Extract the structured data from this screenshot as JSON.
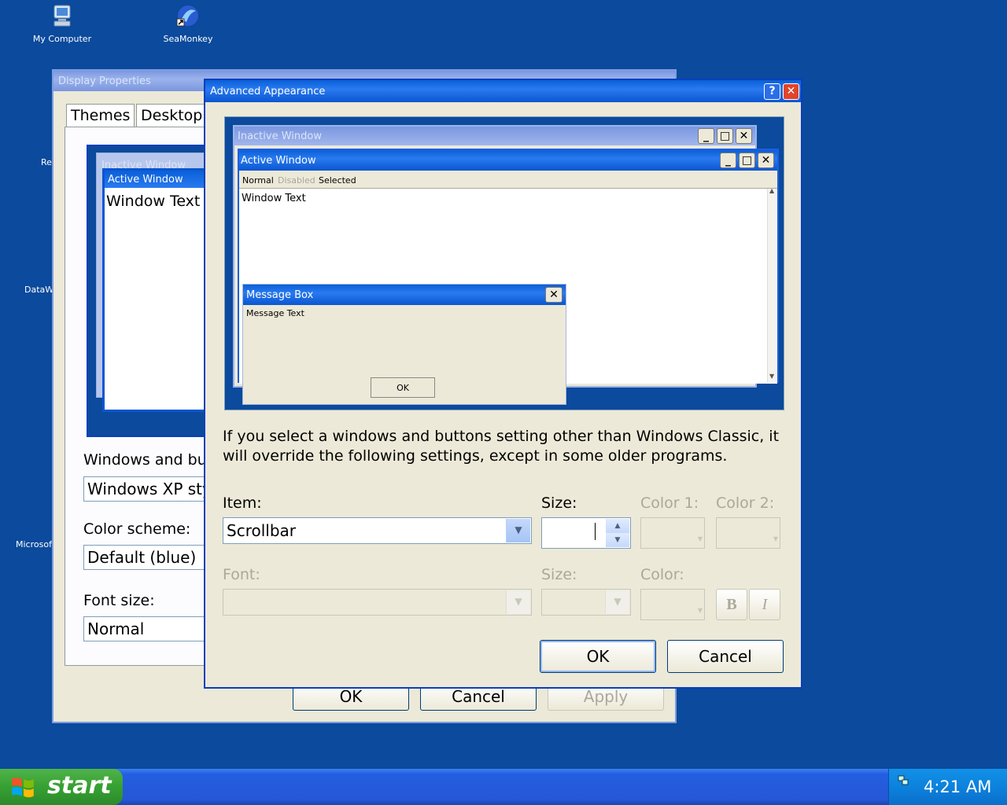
{
  "desktop": {
    "icons": [
      {
        "label": "My Computer",
        "icon": "computer-icon"
      },
      {
        "label": "SeaMonkey",
        "icon": "seamonkey-icon"
      }
    ],
    "edge_labels": [
      "Re",
      "DataW",
      "Microsoft"
    ]
  },
  "display_properties": {
    "title": "Display Properties",
    "tabs": [
      "Themes",
      "Desktop"
    ],
    "preview": {
      "inactive_window": "Inactive Window",
      "active_window": "Active Window",
      "window_text": "Window Text"
    },
    "windows_and_buttons_label": "Windows and bu",
    "windows_and_buttons_value": "Windows XP sty",
    "color_scheme_label": "Color scheme:",
    "color_scheme_value": "Default (blue)",
    "font_size_label": "Font size:",
    "font_size_value": "Normal",
    "ok": "OK",
    "cancel": "Cancel",
    "apply": "Apply"
  },
  "advanced": {
    "title": "Advanced Appearance",
    "help": "?",
    "preview": {
      "inactive_window": "Inactive Window",
      "active_window": "Active Window",
      "menu": {
        "normal": "Normal",
        "disabled": "Disabled",
        "selected": "Selected"
      },
      "window_text": "Window Text",
      "message_box": "Message Box",
      "message_text": "Message Text",
      "ok": "OK"
    },
    "info_line1": "If you select a windows and buttons setting other than Windows Classic, it",
    "info_line2": "will override the following settings, except in some older programs.",
    "item_label": "Item:",
    "item_value": "Scrollbar",
    "size_label": "Size:",
    "color1_label": "Color 1:",
    "color2_label": "Color 2:",
    "font_label": "Font:",
    "font_size_label": "Size:",
    "font_color_label": "Color:",
    "bold": "B",
    "italic": "I",
    "ok": "OK",
    "cancel": "Cancel"
  },
  "taskbar": {
    "start": "start",
    "clock": "4:21 AM"
  }
}
